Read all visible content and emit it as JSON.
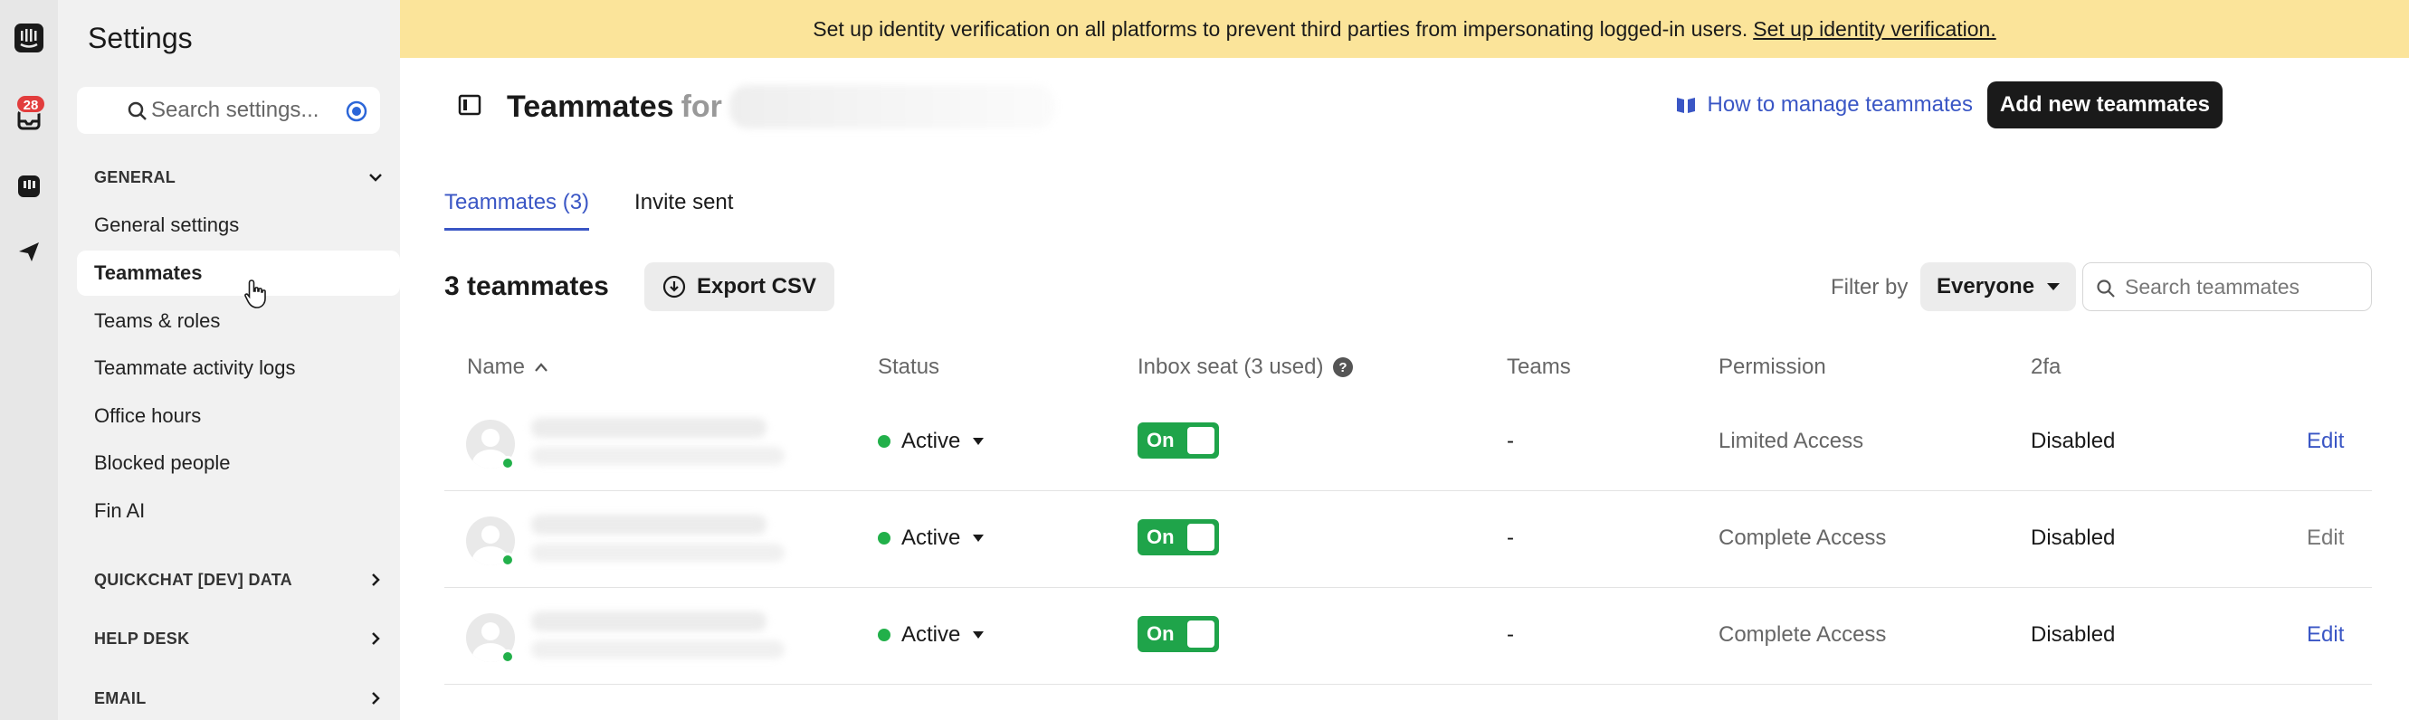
{
  "rail": {
    "inbox_badge": "28"
  },
  "sidebar": {
    "title": "Settings",
    "search_placeholder": "Search settings...",
    "sections": [
      {
        "label": "GENERAL",
        "expanded": true
      },
      {
        "label": "QUICKCHAT [DEV] DATA",
        "expanded": false
      },
      {
        "label": "HELP DESK",
        "expanded": false
      },
      {
        "label": "EMAIL",
        "expanded": false
      }
    ],
    "items": [
      {
        "label": "General settings"
      },
      {
        "label": "Teammates",
        "active": true
      },
      {
        "label": "Teams & roles"
      },
      {
        "label": "Teammate activity logs"
      },
      {
        "label": "Office hours"
      },
      {
        "label": "Blocked people"
      },
      {
        "label": "Fin AI"
      }
    ]
  },
  "banner": {
    "text": "Set up identity verification on all platforms to prevent third parties from impersonating logged-in users.",
    "link": "Set up identity verification."
  },
  "header": {
    "title": "Teammates",
    "title_suffix": "for",
    "help_link": "How to manage teammates",
    "primary_button": "Add new teammates"
  },
  "tabs": [
    {
      "label": "Teammates (3)",
      "active": true
    },
    {
      "label": "Invite sent",
      "active": false
    }
  ],
  "toolbar": {
    "count_title": "3 teammates",
    "export_label": "Export CSV",
    "filter_label": "Filter by",
    "filter_value": "Everyone",
    "search_placeholder": "Search teammates"
  },
  "table": {
    "columns": {
      "name": "Name",
      "status": "Status",
      "inbox_seat": "Inbox seat (3 used)",
      "teams": "Teams",
      "permission": "Permission",
      "twofa": "2fa"
    },
    "rows": [
      {
        "status": "Active",
        "seat": "On",
        "teams": "-",
        "permission": "Limited Access",
        "twofa": "Disabled",
        "action": "Edit",
        "action_enabled": true
      },
      {
        "status": "Active",
        "seat": "On",
        "teams": "-",
        "permission": "Complete Access",
        "twofa": "Disabled",
        "action": "Edit",
        "action_enabled": false
      },
      {
        "status": "Active",
        "seat": "On",
        "teams": "-",
        "permission": "Complete Access",
        "twofa": "Disabled",
        "action": "Edit",
        "action_enabled": true
      }
    ]
  },
  "colors": {
    "accent": "#3a56c5",
    "banner_bg": "#fbe49a",
    "success": "#1fa44a",
    "badge": "#e23d3d"
  }
}
